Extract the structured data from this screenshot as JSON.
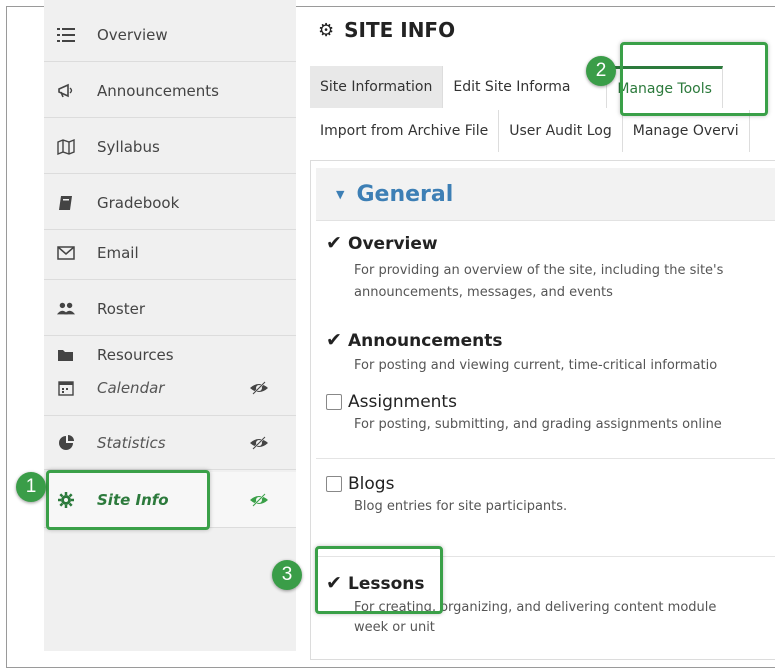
{
  "sidebar": {
    "items": [
      {
        "label": "Overview",
        "icon": "list-icon"
      },
      {
        "label": "Announcements",
        "icon": "megaphone-icon"
      },
      {
        "label": "Syllabus",
        "icon": "map-icon"
      },
      {
        "label": "Gradebook",
        "icon": "book-icon"
      },
      {
        "label": "Email",
        "icon": "envelope-icon"
      },
      {
        "label": "Roster",
        "icon": "users-icon"
      },
      {
        "label": "Resources",
        "icon": "folder-icon"
      },
      {
        "label": "Calendar",
        "icon": "calendar-icon",
        "hidden": true
      },
      {
        "label": "Statistics",
        "icon": "pie-chart-icon",
        "hidden": true
      },
      {
        "label": "Site Info",
        "icon": "gear-icon",
        "active": true
      }
    ]
  },
  "page": {
    "title": "SITE INFO"
  },
  "tabs_row1": [
    "Site Information",
    "Edit Site Informa",
    "Manage Tools"
  ],
  "tabs_row2": [
    "Import from Archive File",
    "User Audit Log",
    "Manage Overvi"
  ],
  "section": {
    "title": "General"
  },
  "tools": [
    {
      "name": "Overview",
      "checked": true,
      "desc1": "For providing an overview of the site, including the site's",
      "desc2": "announcements, messages, and events"
    },
    {
      "name": "Announcements",
      "checked": true,
      "desc1": "For posting and viewing current, time-critical informatio"
    },
    {
      "name": "Assignments",
      "checked": false,
      "desc1": "For posting, submitting, and grading assignments online"
    },
    {
      "name": "Blogs",
      "checked": false,
      "desc1": "Blog entries for site participants."
    },
    {
      "name": "Lessons",
      "checked": true,
      "desc1": "For creating, organizing, and delivering content module",
      "desc2": "week or unit"
    }
  ],
  "callouts": {
    "one": "1",
    "two": "2",
    "three": "3"
  },
  "colors": {
    "accent_green": "#3aa048",
    "link_blue": "#3d7fb5"
  }
}
